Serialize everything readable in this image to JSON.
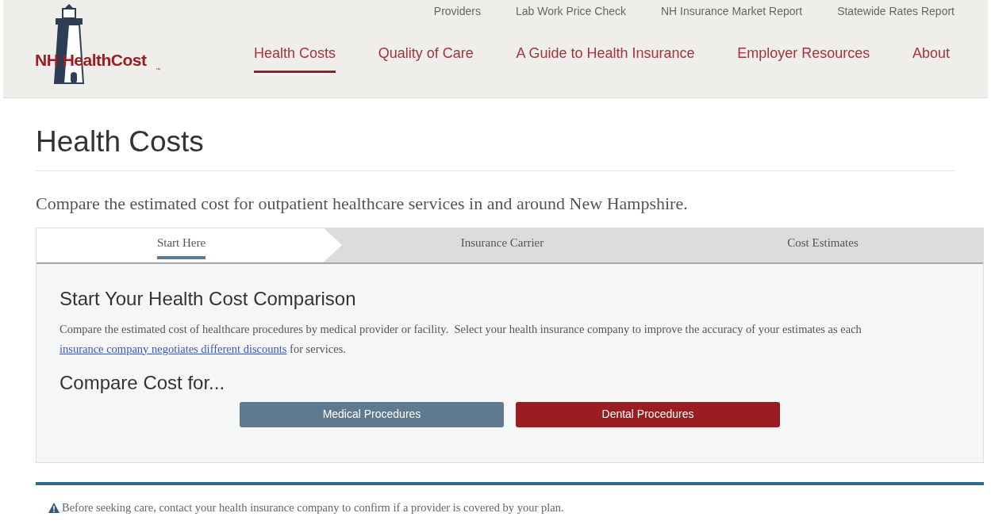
{
  "logo": {
    "name": "NH HealthCost",
    "trademark": "™"
  },
  "top_links": [
    "Providers",
    "Lab Work Price Check",
    "NH Insurance Market Report",
    "Statewide Rates Report"
  ],
  "nav": [
    {
      "label": "Health Costs",
      "selected": true
    },
    {
      "label": "Quality of Care",
      "selected": false
    },
    {
      "label": "A Guide to Health Insurance",
      "selected": false
    },
    {
      "label": "Employer Resources",
      "selected": false
    },
    {
      "label": "About",
      "selected": false
    }
  ],
  "page_title": "Health Costs",
  "intro": "Compare the estimated cost for outpatient healthcare services in and around New Hampshire.",
  "steps": [
    {
      "label": "Start Here",
      "selected": true
    },
    {
      "label": "Insurance Carrier",
      "selected": false
    },
    {
      "label": "Cost Estimates",
      "selected": false
    }
  ],
  "panel": {
    "title": "Start Your Health Cost Comparison",
    "text_before": "Compare the estimated cost of healthcare procedures by medical provider or facility.  Select your health insurance company to improve the accuracy of your estimates as each ",
    "link": "insurance company negotiates different discounts",
    "text_after": " for services.",
    "compare_heading": "Compare Cost for...",
    "buttons": [
      {
        "label": "Medical Procedures",
        "color": "#5f7a8e"
      },
      {
        "label": "Dental Procedures",
        "color": "#9b1c21"
      }
    ]
  },
  "notice": "Before seeking care, contact your health insurance company to confirm if a provider is covered by your plan."
}
